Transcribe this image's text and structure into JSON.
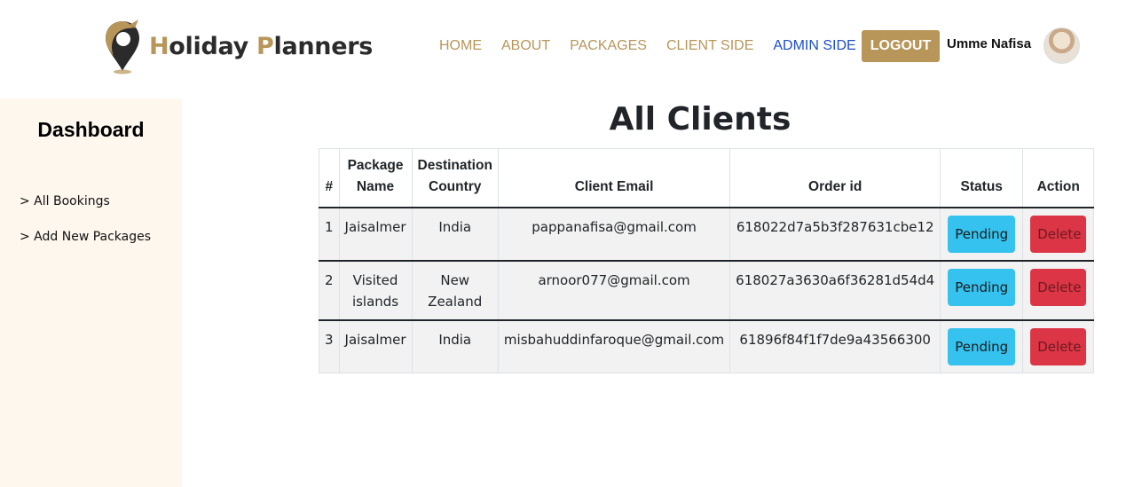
{
  "brand": {
    "first": "H",
    "first_rest": "oliday ",
    "second": "P",
    "second_rest": "lanners"
  },
  "nav": {
    "items": [
      {
        "label": "HOME",
        "active": false
      },
      {
        "label": "ABOUT",
        "active": false
      },
      {
        "label": "PACKAGES",
        "active": false
      },
      {
        "label": "CLIENT SIDE",
        "active": false
      },
      {
        "label": "ADMIN SIDE",
        "active": true
      }
    ],
    "logout_label": "LOGOUT",
    "user_name": "Umme Nafisa"
  },
  "sidebar": {
    "title": "Dashboard",
    "items": [
      {
        "label": "> All Bookings"
      },
      {
        "label": "> Add New Packages"
      }
    ]
  },
  "main": {
    "title": "All Clients",
    "columns": [
      "#",
      "Package Name",
      "Destination Country",
      "Client Email",
      "Order id",
      "Status",
      "Action"
    ],
    "rows": [
      {
        "num": "1",
        "package": "Jaisalmer",
        "country": "India",
        "email": "pappanafisa@gmail.com",
        "order_id": "618022d7a5b3f287631cbe12",
        "status": "Pending",
        "action": "Delete"
      },
      {
        "num": "2",
        "package": "Visited islands",
        "country": "New Zealand",
        "email": "arnoor077@gmail.com",
        "order_id": "618027a3630a6f36281d54d4",
        "status": "Pending",
        "action": "Delete"
      },
      {
        "num": "3",
        "package": "Jaisalmer",
        "country": "India",
        "email": "misbahuddinfaroque@gmail.com",
        "order_id": "61896f84f1f7de9a43566300",
        "status": "Pending",
        "action": "Delete"
      }
    ]
  },
  "colors": {
    "brand_gold": "#b8965a",
    "active_nav": "#1d4fc4",
    "pending": "#36c2ee",
    "delete": "#dc3545",
    "sidebar_bg": "#fdf7ee"
  },
  "icons": {
    "logo": "location-pin-icon"
  }
}
